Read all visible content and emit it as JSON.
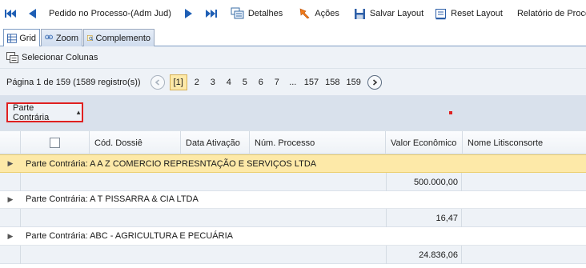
{
  "toolbar": {
    "process_label": "Pedido no Processo-(Adm Jud)",
    "details_label": "Detalhes",
    "actions_label": "Ações",
    "save_layout_label": "Salvar Layout",
    "reset_layout_label": "Reset Layout",
    "report_label": "Relatório de Processos"
  },
  "tabs": [
    {
      "label": "Grid"
    },
    {
      "label": "Zoom"
    },
    {
      "label": "Complemento"
    }
  ],
  "grid": {
    "select_columns_label": "Selecionar Colunas",
    "pager": {
      "info": "Página 1 de 159 (1589 registro(s))",
      "current": "[1]",
      "pages": [
        "2",
        "3",
        "4",
        "5",
        "6",
        "7",
        "...",
        "157",
        "158",
        "159"
      ]
    },
    "group_chip_label": "Parte Contrária",
    "columns": [
      "Cód. Dossiê",
      "Data Ativação",
      "Núm. Processo",
      "Valor Econômico",
      "Nome Litisconsorte"
    ],
    "groups": [
      {
        "label": "Parte Contrária: A A Z COMERCIO REPRESNTAÇÃO E SERVIÇOS LTDA",
        "sum": "500.000,00"
      },
      {
        "label": "Parte Contrária: A T PISSARRA & CIA LTDA",
        "sum": "16,47"
      },
      {
        "label": "Parte Contrária: ABC - AGRICULTURA E PECUÁRIA",
        "sum": "24.836,06"
      }
    ]
  },
  "colors": {
    "accent_blue": "#1f5fb5",
    "selected_row": "#fde9a8",
    "highlight_border": "#e02020"
  }
}
